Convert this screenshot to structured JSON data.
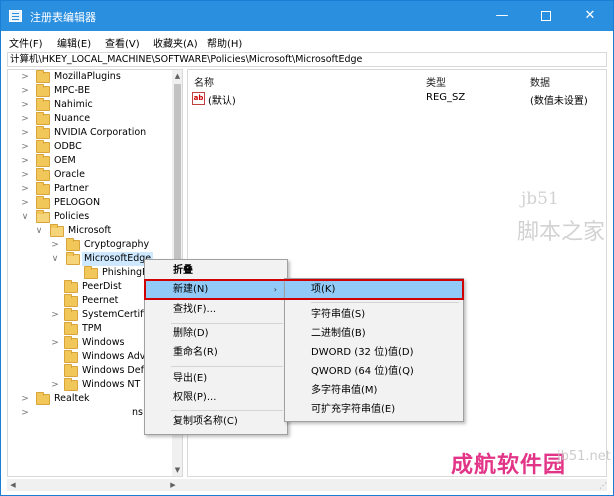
{
  "window": {
    "title": "注册表编辑器",
    "min_glyph": "—",
    "close_glyph": "✕"
  },
  "menubar": {
    "items": [
      "文件(F)",
      "编辑(E)",
      "查看(V)",
      "收藏夹(A)",
      "帮助(H)"
    ]
  },
  "address": {
    "path": "计算机\\HKEY_LOCAL_MACHINE\\SOFTWARE\\Policies\\Microsoft\\MicrosoftEdge"
  },
  "tree": {
    "expander_collapsed": ">",
    "expander_expanded": "∨",
    "items": [
      {
        "label": "MozillaPlugins"
      },
      {
        "label": "MPC-BE"
      },
      {
        "label": "Nahimic"
      },
      {
        "label": "Nuance"
      },
      {
        "label": "NVIDIA Corporation"
      },
      {
        "label": "ODBC"
      },
      {
        "label": "OEM"
      },
      {
        "label": "Oracle"
      },
      {
        "label": "Partner"
      },
      {
        "label": "PELOGON"
      },
      {
        "label": "Policies"
      },
      {
        "label": "Microsoft"
      },
      {
        "label": "Cryptography"
      },
      {
        "label": "MicrosoftEdge"
      },
      {
        "label": "PhishingF"
      },
      {
        "label": "PeerDist"
      },
      {
        "label": "Peernet"
      },
      {
        "label": "SystemCertific"
      },
      {
        "label": "TPM"
      },
      {
        "label": "Windows"
      },
      {
        "label": "Windows Adv"
      },
      {
        "label": "Windows Defe"
      },
      {
        "label": "Windows NT"
      },
      {
        "label": "Realtek"
      }
    ],
    "partial_text": "ns"
  },
  "list": {
    "headers": {
      "name": "名称",
      "type": "类型",
      "data": "数据"
    },
    "rows": [
      {
        "icon": "ab",
        "name": "(默认)",
        "type": "REG_SZ",
        "data": "(数值未设置)"
      }
    ]
  },
  "context_menu": {
    "items": [
      "折叠",
      "新建(N)",
      "查找(F)...",
      "删除(D)",
      "重命名(R)",
      "导出(E)",
      "权限(P)...",
      "复制项名称(C)"
    ],
    "submenu_arrow": "›"
  },
  "submenu": {
    "items": [
      "项(K)",
      "字符串值(S)",
      "二进制值(B)",
      "DWORD (32 位)值(D)",
      "QWORD (64 位)值(Q)",
      "多字符串值(M)",
      "可扩充字符串值(E)"
    ]
  },
  "watermarks": {
    "site": "成航软件园",
    "brand_a": "jb51",
    "brand_b": "脚本之家",
    "brand_c": "jb51.net"
  },
  "colors": {
    "titlebar": "#2b8fe0",
    "highlight": "#91c9f7",
    "annotation": "#d00000",
    "watermark": "#e0207c"
  }
}
